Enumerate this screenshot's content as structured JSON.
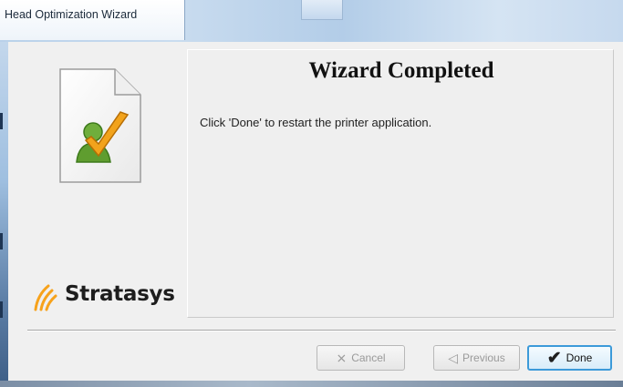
{
  "window": {
    "title": "Head Optimization Wizard"
  },
  "side_panel": {
    "icon": "document-checkmark-user-icon",
    "logo_icon": "stratasys-swoosh-icon",
    "logo_text": "Stratasys"
  },
  "content": {
    "heading": "Wizard Completed",
    "message": "Click 'Done' to restart the printer application."
  },
  "buttons": {
    "cancel": {
      "label": "Cancel",
      "icon": "cancel-icon",
      "enabled": false
    },
    "previous": {
      "label": "Previous",
      "icon": "previous-arrow-icon",
      "enabled": false
    },
    "done": {
      "label": "Done",
      "icon": "checkmark-icon",
      "enabled": true
    }
  },
  "colors": {
    "title_bar": "#b9d1ea",
    "done_border": "#3c9ad9",
    "logo_orange": "#f7a21b"
  }
}
